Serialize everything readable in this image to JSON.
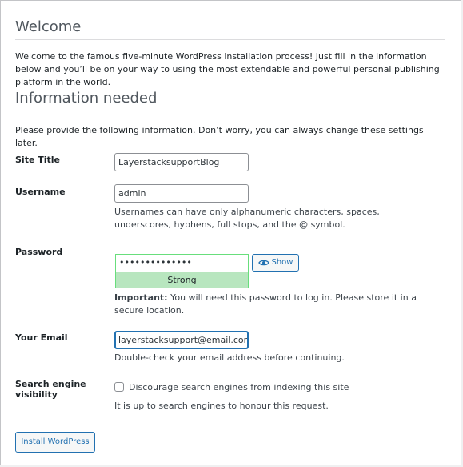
{
  "welcome": {
    "heading": "Welcome",
    "text": "Welcome to the famous five-minute WordPress installation process! Just fill in the information below and you’ll be on your way to using the most extendable and powerful personal publishing platform in the world."
  },
  "info": {
    "heading": "Information needed",
    "text": "Please provide the following information. Don’t worry, you can always change these settings later."
  },
  "form": {
    "site_title": {
      "label": "Site Title",
      "value": "LayerstacksupportBlog"
    },
    "username": {
      "label": "Username",
      "value": "admin",
      "hint": "Usernames can have only alphanumeric characters, spaces, underscores, hyphens, full stops, and the @ symbol."
    },
    "password": {
      "label": "Password",
      "masked_value": "••••••••••••••",
      "show_label": "Show",
      "strength": "Strong",
      "important_label": "Important:",
      "important_text": " You will need this password to log in. Please store it in a secure location."
    },
    "email": {
      "label": "Your Email",
      "value": "layerstacksupport@email.com",
      "hint": "Double-check your email address before continuing."
    },
    "search_visibility": {
      "label_line1": "Search engine",
      "label_line2": "visibility",
      "checkbox_label": "Discourage search engines from indexing this site",
      "checked": false,
      "hint": "It is up to search engines to honour this request."
    },
    "submit_label": "Install WordPress"
  },
  "colors": {
    "accent": "#2271b1",
    "strength_bg": "#b8e6bf",
    "strength_border": "#68de7c"
  }
}
